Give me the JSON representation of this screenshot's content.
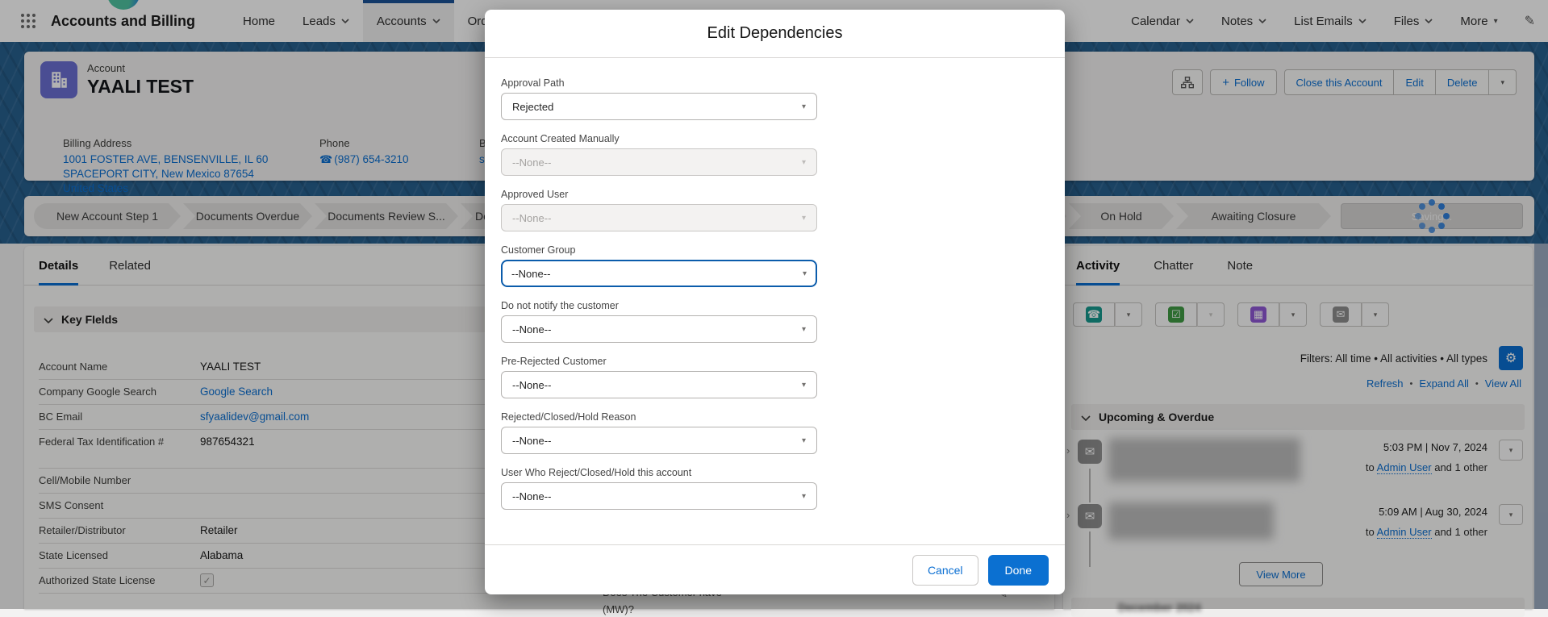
{
  "nav": {
    "app_name": "Accounts and Billing",
    "items_left": [
      {
        "label": "Home"
      },
      {
        "label": "Leads"
      },
      {
        "label": "Accounts",
        "selected": true
      },
      {
        "label": "Orders"
      }
    ],
    "items_right": [
      {
        "label": "Calendar"
      },
      {
        "label": "Notes"
      },
      {
        "label": "List Emails"
      },
      {
        "label": "Files"
      },
      {
        "label": "More"
      }
    ]
  },
  "header": {
    "entity_label": "Account",
    "account_name": "YAALI TEST",
    "follow_plus": "+",
    "follow_label": "Follow",
    "buttons": [
      "Close this Account",
      "Edit",
      "Delete"
    ],
    "billing": {
      "label": "Billing Address",
      "line1": "1001 FOSTER AVE, BENSENVILLE, IL 60",
      "line2": "SPACEPORT CITY, New Mexico 87654",
      "line3": "United States"
    },
    "phone": {
      "label": "Phone",
      "value": "(987) 654-3210"
    },
    "bc_email": {
      "label": "BC Email",
      "value": "sfyaalidev@gmail.com"
    }
  },
  "path": {
    "steps": [
      "New Account Step 1",
      "Documents Overdue",
      "Documents Review S...",
      "Do",
      "",
      "On Hold",
      "Awaiting Closure"
    ],
    "saving_label": "Saving..."
  },
  "details": {
    "tabs": [
      "Details",
      "Related"
    ],
    "section_title": "Key FIelds",
    "rows": [
      {
        "label": "Account Name",
        "value": "YAALI TEST",
        "type": "text"
      },
      {
        "label": "Company Google Search",
        "value": "Google Search",
        "type": "link"
      },
      {
        "label": "BC Email",
        "value": "sfyaalidev@gmail.com",
        "type": "link"
      },
      {
        "label": "Federal Tax Identification #",
        "value": "987654321",
        "type": "text"
      },
      {
        "label": "Cell/Mobile Number",
        "value": "",
        "type": "text"
      },
      {
        "label": "SMS Consent",
        "value": "",
        "type": "text"
      },
      {
        "label": "Retailer/Distributor",
        "value": "Retailer",
        "type": "text"
      },
      {
        "label": "State Licensed",
        "value": "Alabama",
        "type": "text"
      },
      {
        "label": "Authorized State License",
        "value": "checked",
        "type": "checkbox"
      }
    ],
    "partial_row": {
      "line1": "Does The Customer have",
      "line2": "(MW)?"
    }
  },
  "activity": {
    "tabs": [
      "Activity",
      "Chatter",
      "Note"
    ],
    "filters_text": "Filters: All time • All activities • All types",
    "links": [
      "Refresh",
      "Expand All",
      "View All"
    ],
    "separator": "•",
    "section_title": "Upcoming & Overdue",
    "items": [
      {
        "time": "5:03 PM | Nov 7, 2024",
        "to_prefix": "to",
        "recipient": "Admin User",
        "suffix": "and 1 other"
      },
      {
        "time": "5:09 AM | Aug 30, 2024",
        "to_prefix": "to",
        "recipient": "Admin User",
        "suffix": "and 1 other"
      }
    ],
    "view_more": "View More",
    "month_header": "December 2024"
  },
  "modal": {
    "title": "Edit Dependencies",
    "fields": [
      {
        "label": "Approval Path",
        "value": "Rejected",
        "state": "enabled"
      },
      {
        "label": "Account Created Manually",
        "value": "--None--",
        "state": "disabled"
      },
      {
        "label": "Approved User",
        "value": "--None--",
        "state": "disabled"
      },
      {
        "label": "Customer Group",
        "value": "--None--",
        "state": "focused"
      },
      {
        "label": "Do not notify the customer",
        "value": "--None--",
        "state": "enabled"
      },
      {
        "label": "Pre-Rejected Customer",
        "value": "--None--",
        "state": "enabled"
      },
      {
        "label": "Rejected/Closed/Hold Reason",
        "value": "--None--",
        "state": "enabled"
      },
      {
        "label": "User Who Reject/Closed/Hold this account",
        "value": "--None--",
        "state": "enabled"
      }
    ],
    "cancel_label": "Cancel",
    "done_label": "Done"
  },
  "icons": {
    "caret": "▾",
    "phone": "☎",
    "email": "✉",
    "gear": "⚙",
    "pencil": "✎",
    "check": "✓",
    "task": "☑",
    "event": "▦",
    "chevron_right": "›"
  },
  "colors": {
    "accent": "#0b6fd2",
    "selected_tab_bar": "#1b5297",
    "account_icon": "#6b6fd3",
    "call_action": "#169a8e",
    "task_action": "#3f9b44",
    "event_action": "#9058d6",
    "email_action": "#8f8f8f",
    "spinner": "#2e7fdb",
    "banner": "#27608f"
  }
}
